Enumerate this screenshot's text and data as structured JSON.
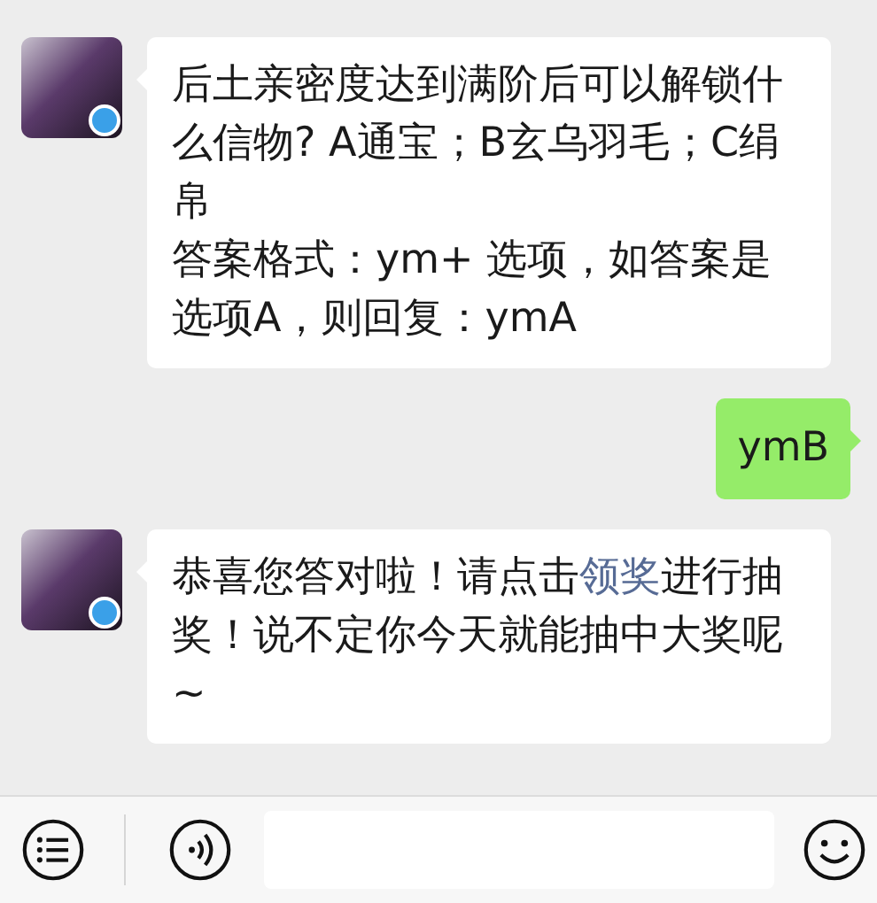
{
  "messages": [
    {
      "kind": "received",
      "paragraphs": [
        [
          {
            "kind": "text",
            "text": "后土亲密度达到满阶后可以解锁什么信物? A通宝；B玄乌羽毛；C绢帛"
          }
        ],
        [
          {
            "kind": "text",
            "text": "答案格式：ym+ 选项，如答案是选项A，则回复：ymA"
          }
        ]
      ]
    },
    {
      "kind": "sent",
      "paragraphs": [
        [
          {
            "kind": "text",
            "text": "ymB"
          }
        ]
      ]
    },
    {
      "kind": "received",
      "paragraphs": [
        [
          {
            "kind": "text",
            "text": "恭喜您答对啦！请点击"
          },
          {
            "kind": "link",
            "text": "领奖"
          },
          {
            "kind": "text",
            "text": "进行抽奖！说不定你今天就能抽中大奖呢~"
          }
        ]
      ]
    }
  ]
}
